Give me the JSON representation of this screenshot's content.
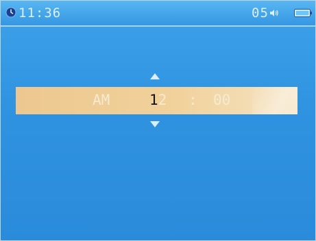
{
  "status_bar": {
    "time": "11:36",
    "volume_level": "05",
    "icons": [
      "clock-icon",
      "speaker-icon",
      "battery-icon"
    ]
  },
  "time_setting": {
    "ampm": "AM",
    "hour_active_digit": "1",
    "hour_other_digit": "2",
    "separator": ":",
    "minute": "00"
  },
  "colors": {
    "background": "#2f93e0",
    "selector_bar": "#f1d19a",
    "active_digit": "#111111",
    "text_light": "#dcefff"
  }
}
